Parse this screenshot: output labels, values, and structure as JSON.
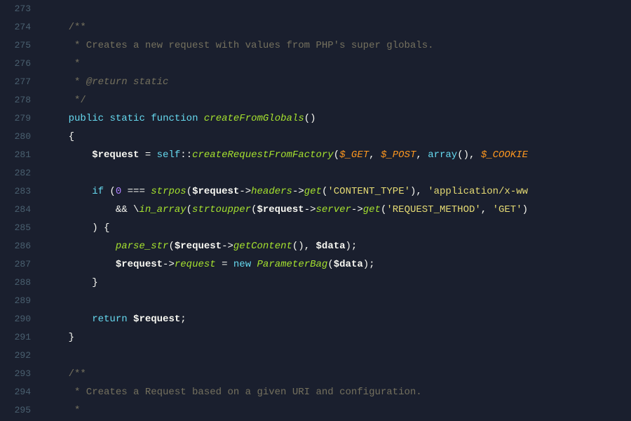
{
  "editor": {
    "background": "#1a1f2e",
    "lines": [
      {
        "num": 273,
        "content": ""
      },
      {
        "num": 274,
        "content": "    /**"
      },
      {
        "num": 275,
        "content": "     * Creates a new request with values from PHP's super globals."
      },
      {
        "num": 276,
        "content": "     *"
      },
      {
        "num": 277,
        "content": "     * @return static"
      },
      {
        "num": 278,
        "content": "     */"
      },
      {
        "num": 279,
        "content": "    public static function createFromGlobals()"
      },
      {
        "num": 280,
        "content": "    {"
      },
      {
        "num": 281,
        "content": "        $request = self::createRequestFromFactory($_GET, $_POST, array(), $_COOKIE"
      },
      {
        "num": 282,
        "content": ""
      },
      {
        "num": 283,
        "content": "        if (0 === strpos($request->headers->get('CONTENT_TYPE'), 'application/x-ww"
      },
      {
        "num": 284,
        "content": "            && \\in_array(strtoupper($request->server->get('REQUEST_METHOD', 'GET')"
      },
      {
        "num": 285,
        "content": "        ) {"
      },
      {
        "num": 286,
        "content": "            parse_str($request->getContent(), $data);"
      },
      {
        "num": 287,
        "content": "            $request->request = new ParameterBag($data);"
      },
      {
        "num": 288,
        "content": "        }"
      },
      {
        "num": 289,
        "content": ""
      },
      {
        "num": 290,
        "content": "        return $request;"
      },
      {
        "num": 291,
        "content": "    }"
      },
      {
        "num": 292,
        "content": ""
      },
      {
        "num": 293,
        "content": "    /**"
      },
      {
        "num": 294,
        "content": "     * Creates a Request based on a given URI and configuration."
      },
      {
        "num": 295,
        "content": "     *"
      }
    ]
  }
}
